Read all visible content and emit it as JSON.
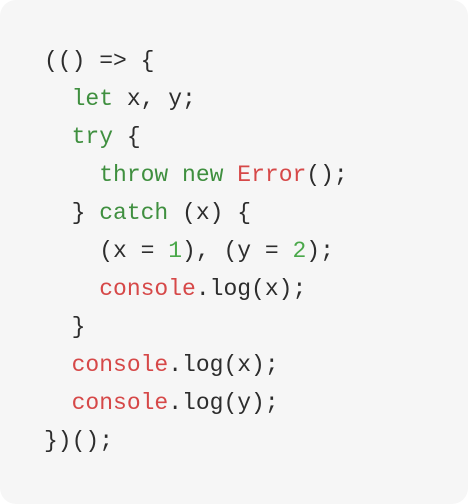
{
  "code": {
    "lines": [
      {
        "tokens": [
          {
            "text": "(() => {",
            "kind": "plain"
          }
        ]
      },
      {
        "tokens": [
          {
            "text": "  ",
            "kind": "plain"
          },
          {
            "text": "let",
            "kind": "keyword"
          },
          {
            "text": " x, y;",
            "kind": "plain"
          }
        ]
      },
      {
        "tokens": [
          {
            "text": "  ",
            "kind": "plain"
          },
          {
            "text": "try",
            "kind": "keyword"
          },
          {
            "text": " {",
            "kind": "plain"
          }
        ]
      },
      {
        "tokens": [
          {
            "text": "    ",
            "kind": "plain"
          },
          {
            "text": "throw",
            "kind": "keyword"
          },
          {
            "text": " ",
            "kind": "plain"
          },
          {
            "text": "new",
            "kind": "keyword"
          },
          {
            "text": " ",
            "kind": "plain"
          },
          {
            "text": "Error",
            "kind": "identifier"
          },
          {
            "text": "();",
            "kind": "plain"
          }
        ]
      },
      {
        "tokens": [
          {
            "text": "  } ",
            "kind": "plain"
          },
          {
            "text": "catch",
            "kind": "keyword"
          },
          {
            "text": " (x) {",
            "kind": "plain"
          }
        ]
      },
      {
        "tokens": [
          {
            "text": "    (x = ",
            "kind": "plain"
          },
          {
            "text": "1",
            "kind": "number"
          },
          {
            "text": "), (y = ",
            "kind": "plain"
          },
          {
            "text": "2",
            "kind": "number"
          },
          {
            "text": ");",
            "kind": "plain"
          }
        ]
      },
      {
        "tokens": [
          {
            "text": "    ",
            "kind": "plain"
          },
          {
            "text": "console",
            "kind": "identifier"
          },
          {
            "text": ".log(x);",
            "kind": "plain"
          }
        ]
      },
      {
        "tokens": [
          {
            "text": "  }",
            "kind": "plain"
          }
        ]
      },
      {
        "tokens": [
          {
            "text": "  ",
            "kind": "plain"
          },
          {
            "text": "console",
            "kind": "identifier"
          },
          {
            "text": ".log(x);",
            "kind": "plain"
          }
        ]
      },
      {
        "tokens": [
          {
            "text": "  ",
            "kind": "plain"
          },
          {
            "text": "console",
            "kind": "identifier"
          },
          {
            "text": ".log(y);",
            "kind": "plain"
          }
        ]
      },
      {
        "tokens": [
          {
            "text": "})();",
            "kind": "plain"
          }
        ]
      }
    ]
  },
  "colors": {
    "background": "#f6f6f6",
    "text": "#2d2d2d",
    "keyword": "#3f8f3f",
    "identifier": "#d64848",
    "number": "#4aa84a"
  }
}
